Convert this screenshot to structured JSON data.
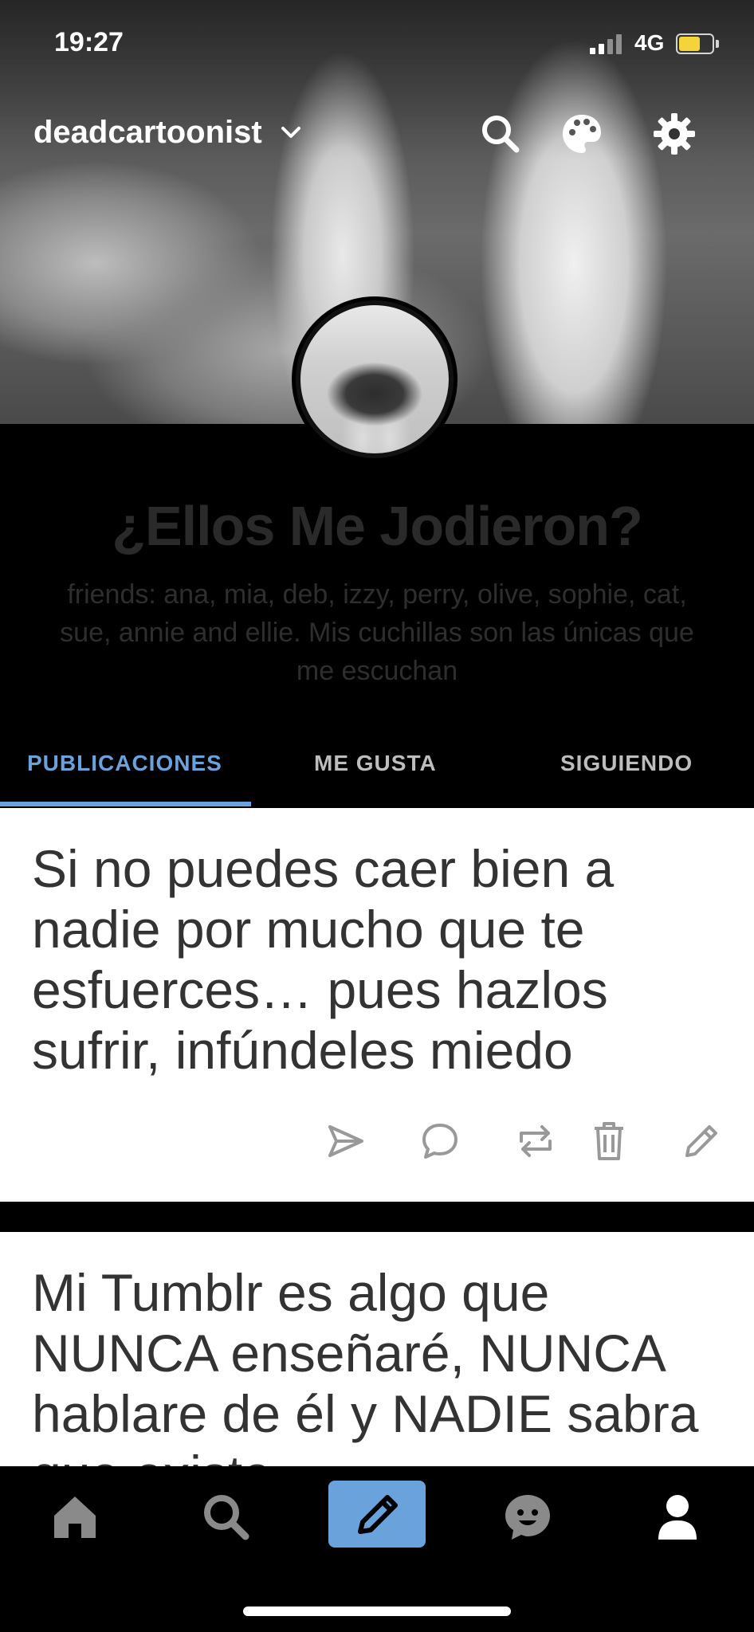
{
  "status_bar": {
    "time": "19:27",
    "network": "4G"
  },
  "header": {
    "blog_name": "deadcartoonist",
    "icons": [
      "search-icon",
      "palette-icon",
      "gear-icon"
    ]
  },
  "profile": {
    "title": "¿Ellos Me Jodieron?",
    "description": "friends: ana, mia, deb, izzy, perry, olive, sophie, cat, sue, annie and ellie. Mis cuchillas son las únicas que me escuchan"
  },
  "tabs": [
    {
      "label": "PUBLICACIONES",
      "active": true
    },
    {
      "label": "ME GUSTA",
      "active": false
    },
    {
      "label": "SIGUIENDO",
      "active": false
    }
  ],
  "posts": [
    {
      "text": "Si no puedes caer bien a nadie por mucho que te esfuerces… pues hazlos sufrir, infúndeles miedo"
    },
    {
      "text": "Mi Tumblr es algo que NUNCA enseñaré, NUNCA hablare de él y NADIE sabra que existe"
    }
  ],
  "post_actions": [
    "send-icon",
    "reply-icon",
    "reblog-icon",
    "delete-icon",
    "edit-icon"
  ],
  "bottom_nav": [
    "home-icon",
    "search-icon",
    "compose-icon",
    "activity-icon",
    "account-icon"
  ],
  "colors": {
    "accent": "#6aa3dc",
    "background": "#000000",
    "post_bg": "#ffffff"
  }
}
